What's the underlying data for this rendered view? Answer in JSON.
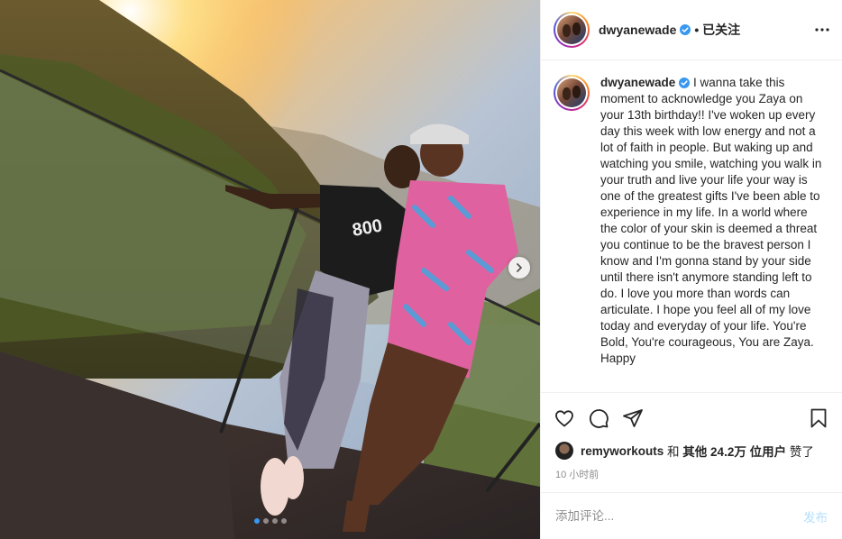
{
  "header": {
    "username": "dwyanewade",
    "follow_status": "• 已关注"
  },
  "caption": {
    "username": "dwyanewade",
    "text": "I wanna take this moment to acknowledge you Zaya on your 13th birthday!! I've woken up every day this week with low energy and not a lot of faith in people. But waking up and watching you smile, watching you walk in your truth and live your life your way is one of the greatest gifts I've been able to experience in my life. In a world where the color of your skin is deemed a threat you continue to be the bravest person I know and I'm gonna stand by your side until there isn't anymore standing left to do. I love you more than words can articulate. I hope you feel all of my love today and everyday of your life. You're Bold, You're courageous, You are Zaya. Happy"
  },
  "likes": {
    "liker": "remyworkouts",
    "connector": " 和 ",
    "others": "其他 24.2万 位用户",
    "suffix": " 赞了"
  },
  "timestamp": "10 小时前",
  "comment": {
    "placeholder": "添加评论...",
    "post_label": "发布"
  },
  "carousel": {
    "slide_count": 4,
    "active_index": 0
  },
  "colors": {
    "verified_blue": "#3897f0",
    "post_button_disabled": "#b2dffc",
    "muted_text": "#8e8e8e"
  },
  "icons": [
    "verified-badge-icon",
    "more-options-icon",
    "heart-icon",
    "comment-icon",
    "share-icon",
    "bookmark-icon",
    "chevron-right-icon"
  ]
}
